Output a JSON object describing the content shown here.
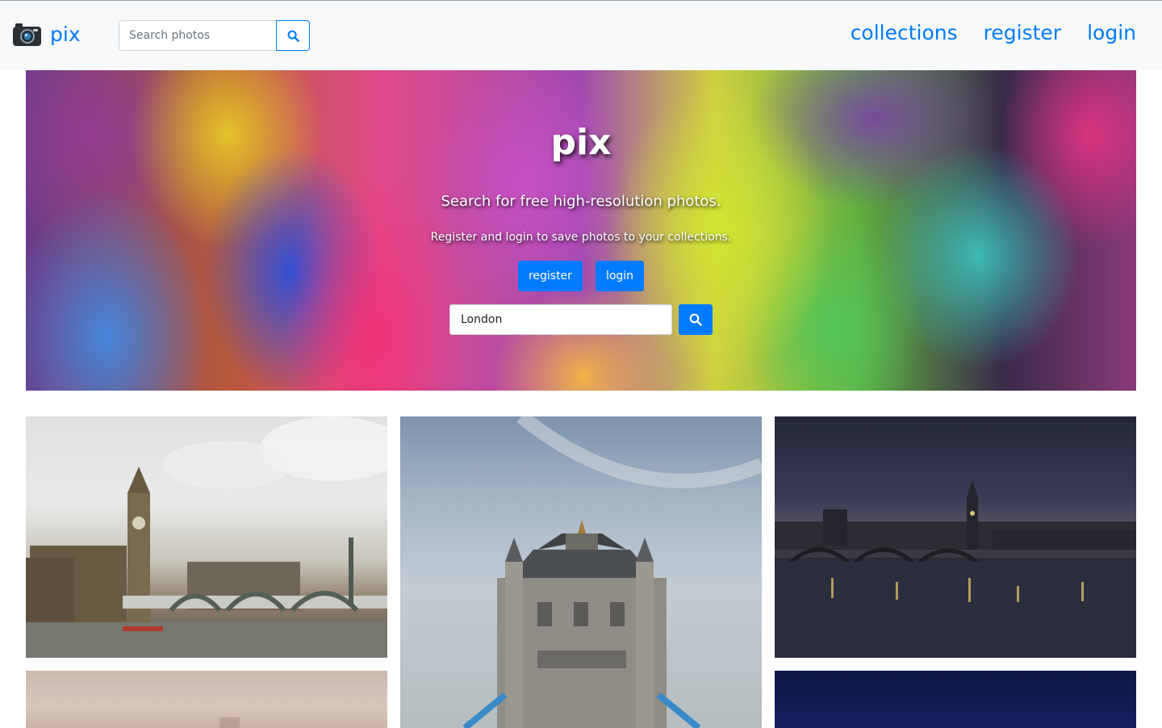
{
  "brand": {
    "name": "pix",
    "logo_icon": "camera-icon"
  },
  "navbar": {
    "search_placeholder": "Search photos",
    "search_icon": "search-icon",
    "links": {
      "collections": "collections",
      "register": "register",
      "login": "login"
    }
  },
  "hero": {
    "title": "pix",
    "subtitle": "Search for free high-resolution photos.",
    "note": "Register and login to save photos to your collections.",
    "register_label": "register",
    "login_label": "login",
    "search_value": "London",
    "search_icon": "search-icon"
  },
  "photos": [
    {
      "subject": "Big Ben and Westminster Bridge by day"
    },
    {
      "subject": "Tower Bridge tower"
    },
    {
      "subject": "Westminster at dusk over the Thames"
    },
    {
      "subject": "hazy skyline"
    },
    {
      "subject": "night sky"
    }
  ],
  "colors": {
    "accent": "#007bff",
    "navbar_bg": "#f8f9fa"
  }
}
